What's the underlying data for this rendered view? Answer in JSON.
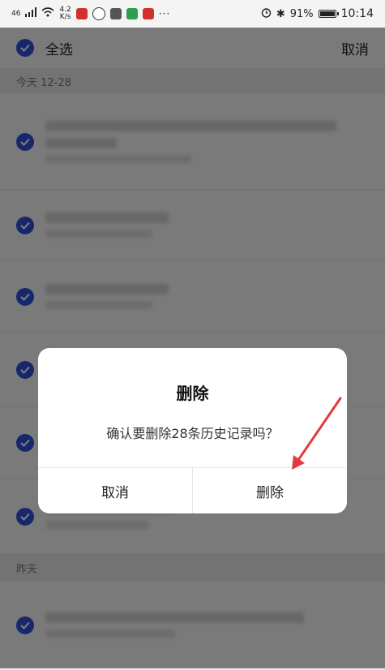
{
  "status_bar": {
    "signal": "46",
    "net_speed_value": "4.2",
    "net_speed_unit": "K/s",
    "battery": "91%",
    "time": "10:14",
    "more": "···"
  },
  "toolbar": {
    "select_all_label": "全选",
    "cancel_label": "取消"
  },
  "sections": [
    {
      "header": "今天  12-28"
    },
    {
      "header": "昨天"
    }
  ],
  "dialog": {
    "title": "删除",
    "message": "确认要删除28条历史记录吗？",
    "cancel_label": "取消",
    "confirm_label": "删除"
  },
  "colors": {
    "accent": "#2f4fd6",
    "arrow": "#e23a3a"
  }
}
